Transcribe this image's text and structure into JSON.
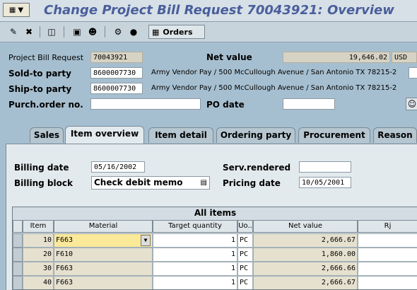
{
  "window": {
    "title": "Change Project Bill Request 70043921: Overview"
  },
  "toolbar": {
    "icons": [
      "display-change-icon",
      "delete-icon",
      "document-flow-icon",
      "header-details-icon",
      "partner-icon",
      "analysis-icon",
      "status-icon"
    ],
    "orders_label": "Orders"
  },
  "header": {
    "project_bill_request_label": "Project Bill Request",
    "project_bill_request_value": "70043921",
    "net_value_label": "Net value",
    "net_value": "19,646.02",
    "currency": "USD",
    "sold_to_label": "Sold-to party",
    "sold_to_value": "8600007730",
    "sold_to_desc": "Army Vendor Pay / 500 McCullough Avenue / San Antonio TX 78215-2",
    "ship_to_label": "Ship-to party",
    "ship_to_value": "8600007730",
    "ship_to_desc": "Army Vendor Pay / 500 McCullough Avenue / San Antonio TX 78215-2",
    "purch_order_label": "Purch.order no.",
    "purch_order_value": "",
    "po_date_label": "PO date",
    "po_date_value": ""
  },
  "tabs": [
    "Sales",
    "Item overview",
    "Item detail",
    "Ordering party",
    "Procurement",
    "Reason"
  ],
  "active_tab": "Item overview",
  "item_overview": {
    "billing_date_label": "Billing date",
    "billing_date_value": "05/16/2002",
    "serv_rendered_label": "Serv.rendered",
    "serv_rendered_value": "",
    "billing_block_label": "Billing block",
    "billing_block_value": "Check debit memo",
    "pricing_date_label": "Pricing date",
    "pricing_date_value": "10/05/2001"
  },
  "items_table": {
    "title": "All items",
    "columns": [
      "Item",
      "Material",
      "Target quantity",
      "Uo..",
      "Net value",
      "Rj"
    ],
    "rows": [
      {
        "item": "10",
        "material": "F663",
        "qty": "1",
        "uom": "PC",
        "net_value": "2,666.67"
      },
      {
        "item": "20",
        "material": "F610",
        "qty": "1",
        "uom": "PC",
        "net_value": "1,860.00"
      },
      {
        "item": "30",
        "material": "F663",
        "qty": "1",
        "uom": "PC",
        "net_value": "2,666.66"
      },
      {
        "item": "40",
        "material": "F663",
        "qty": "1",
        "uom": "PC",
        "net_value": "2,666.67"
      }
    ]
  },
  "colors": {
    "title": "#4a5e9c",
    "background": "#a6bfd0",
    "highlight_cell": "#fbe99a"
  }
}
